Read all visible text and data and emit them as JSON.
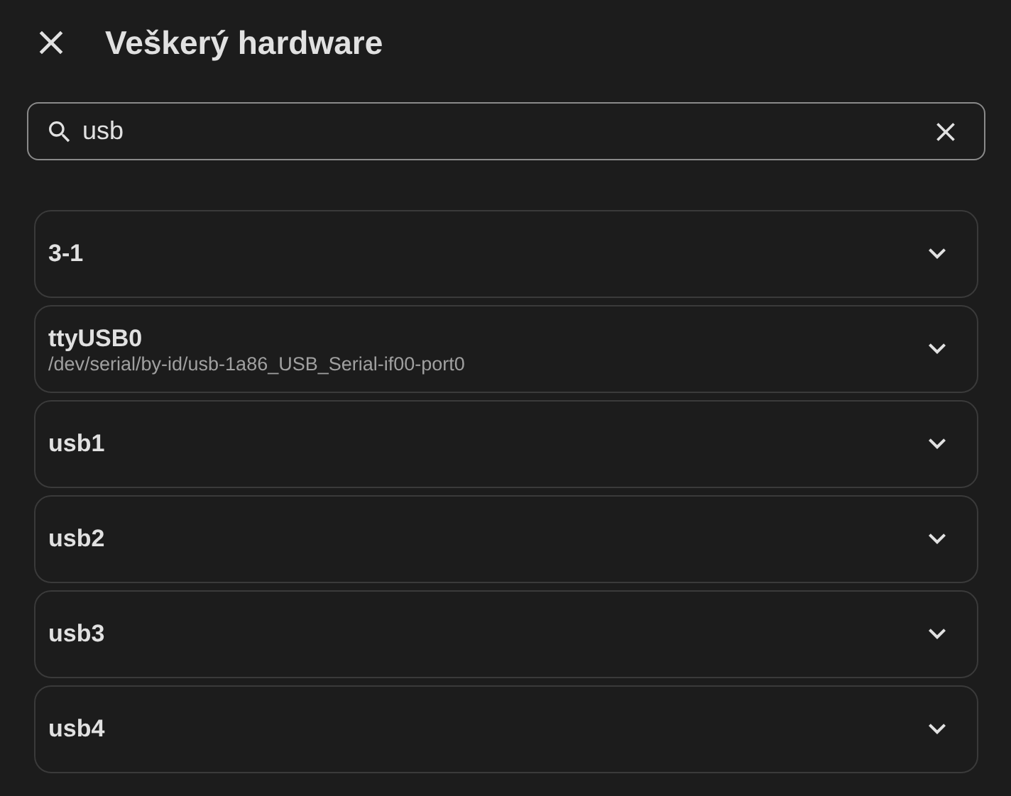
{
  "dialog": {
    "title": "Veškerý hardware"
  },
  "search": {
    "value": "usb"
  },
  "devices": [
    {
      "name": "3-1",
      "expanded": false
    },
    {
      "name": "ttyUSB0",
      "path": "/dev/serial/by-id/usb-1a86_USB_Serial-if00-port0",
      "expanded": false
    },
    {
      "name": "usb1",
      "expanded": false
    },
    {
      "name": "usb2",
      "expanded": false
    },
    {
      "name": "usb3",
      "expanded": false
    },
    {
      "name": "usb4",
      "expanded": false
    }
  ]
}
